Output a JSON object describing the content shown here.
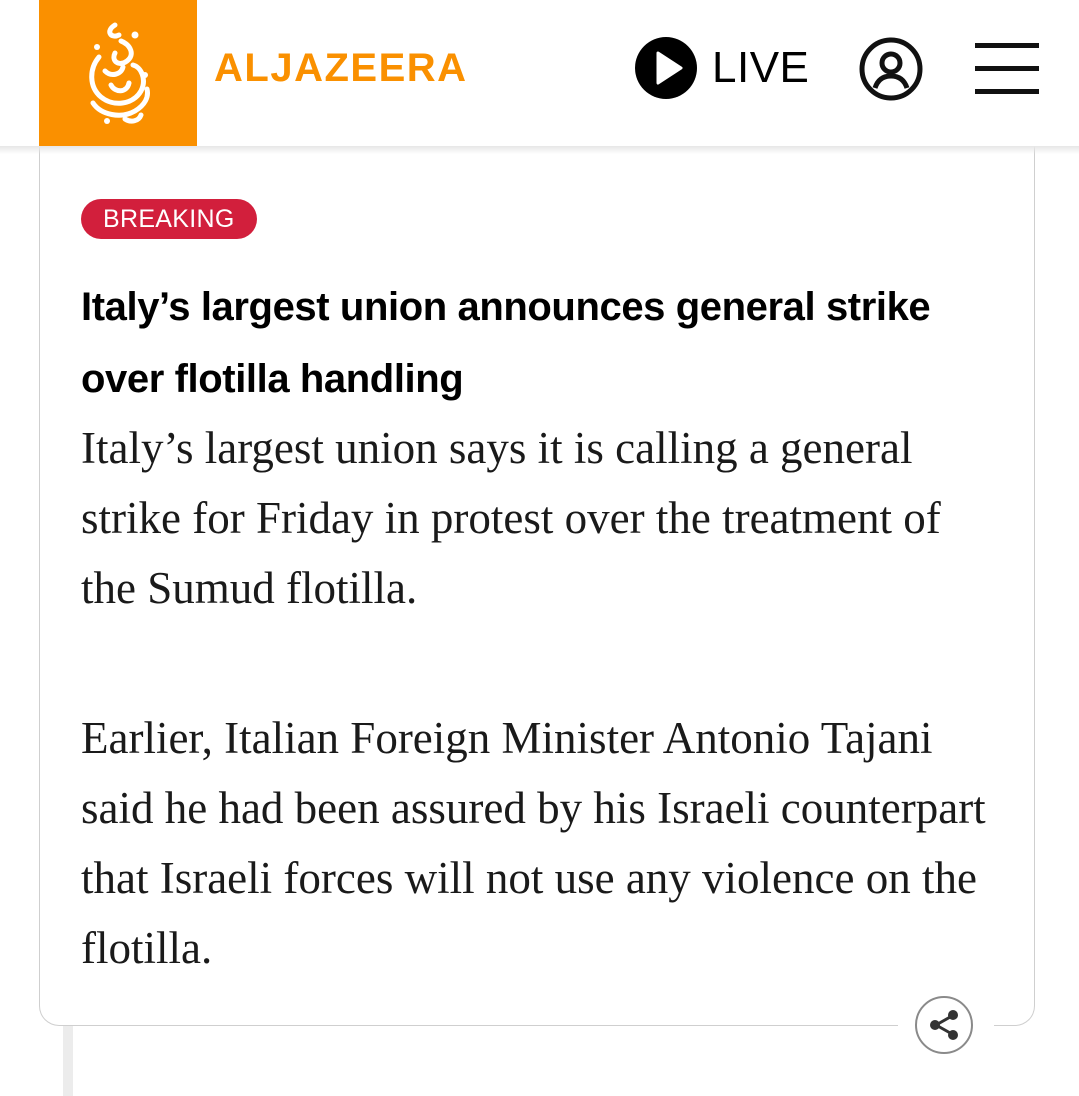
{
  "header": {
    "brand_name": "ALJAZEERA",
    "live_label": "LIVE",
    "logo_icon": "aljazeera-calligraphy-logo",
    "account_icon": "user-account-icon",
    "menu_icon": "hamburger-menu-icon",
    "brand_color": "#fa9000"
  },
  "post": {
    "badge": "BREAKING",
    "badge_color": "#d21f3c",
    "headline": "Italy’s largest union announces general strike over flotilla handling",
    "paragraphs": [
      "Italy’s largest union says it is calling a general strike for Friday in protest over the treatment of the Sumud flotilla.",
      "Earlier, Italian Foreign Minister Antonio Tajani said he had been assured by his Israeli counterpart that Israeli forces will not use any violence on the flotilla."
    ],
    "share_icon": "share-icon"
  }
}
